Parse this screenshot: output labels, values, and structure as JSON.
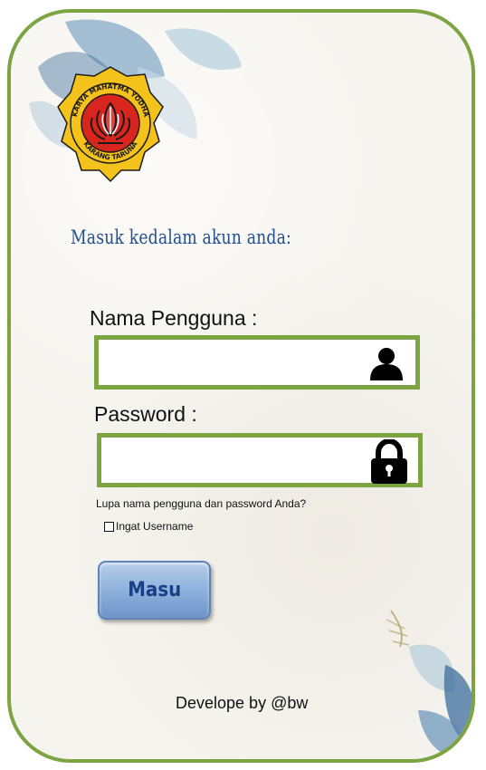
{
  "logo": {
    "ring_top_text": "KARYA MAHATMA YODHA",
    "ring_bottom_text": "KARANG TARUNA",
    "colors": {
      "ring": "#f3c21b",
      "center": "#d8261f",
      "outline": "#1a1a1a"
    }
  },
  "heading": "Masuk kedalam akun anda:",
  "username": {
    "label": "Nama Pengguna :",
    "value": "",
    "icon": "user-icon"
  },
  "password": {
    "label": "Password  :",
    "value": "",
    "icon": "lock-icon"
  },
  "forgot_link": "Lupa nama pengguna dan password Anda?",
  "remember": {
    "label": "Ingat Username",
    "checked": false
  },
  "submit_label": "Masu",
  "footer": "Develope by @bw",
  "colors": {
    "accent_border": "#7ca443",
    "heading": "#1f4f8f",
    "button": "#8fb1dd"
  }
}
